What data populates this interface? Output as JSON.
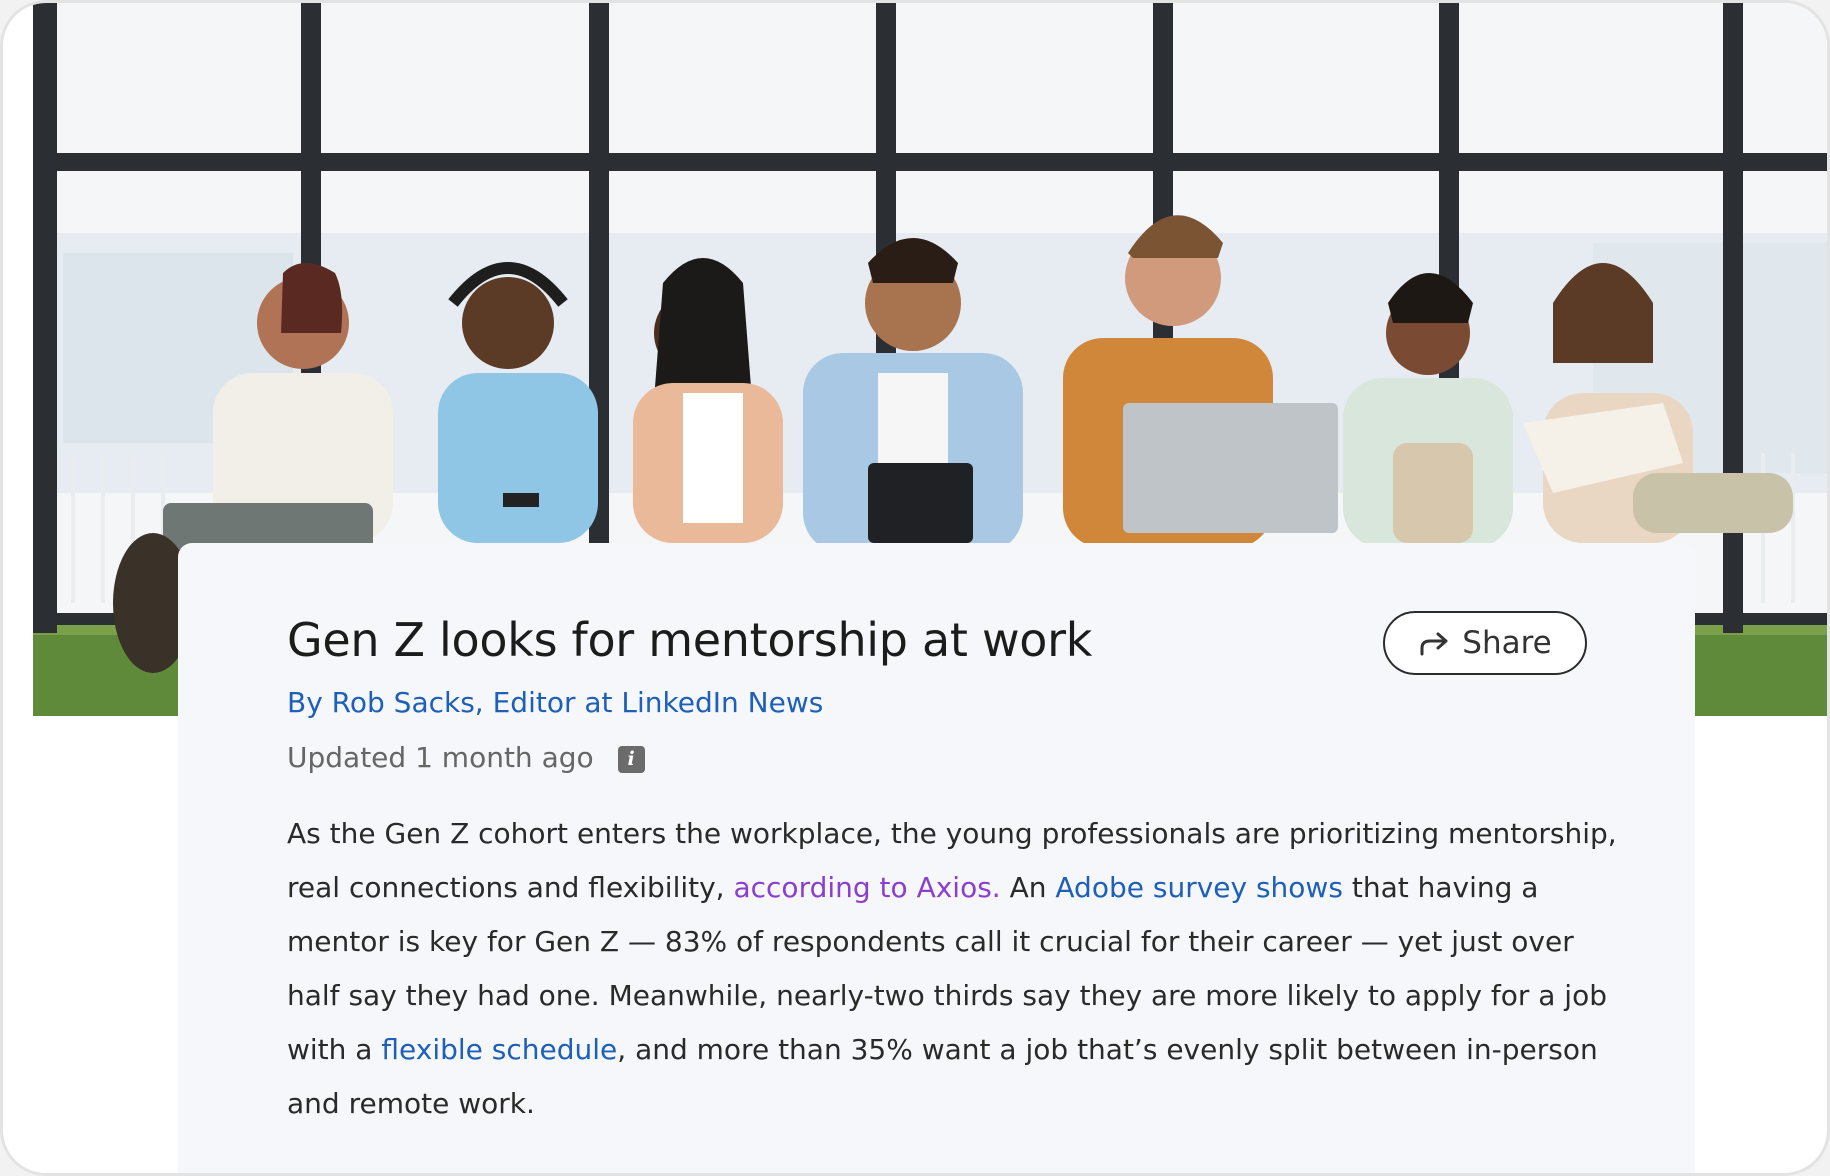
{
  "article": {
    "title": "Gen Z looks for mentorship at work",
    "share_label": "Share",
    "byline": "By Rob Sacks, Editor at LinkedIn News",
    "updated": "Updated 1 month ago",
    "info_glyph": "i",
    "body": {
      "p1": "As the Gen Z cohort enters the workplace, the young professionals are prioritizing mentorship, real connections and flexibility, ",
      "link1": "according to Axios.",
      "p2": " An ",
      "link2": "Adobe survey shows",
      "p3": " that having a mentor is key for Gen Z — 83% of respondents call it crucial for their career — yet just over half say they had one. Meanwhile, nearly-two thirds say they are more likely to apply for a job with a ",
      "link3": "flexible schedule",
      "p4": ", and more than 35% want a job that’s evenly split between in-person and remote work."
    }
  },
  "hero": {
    "image_icon": "people-studying-photo"
  },
  "icons": {
    "share": "share-arrow-icon",
    "info": "info-icon"
  },
  "colors": {
    "link": "#1e5fb8",
    "link_visited": "#8a3fd1",
    "title": "#1c1c1c",
    "card_bg": "#f6f7fb"
  }
}
